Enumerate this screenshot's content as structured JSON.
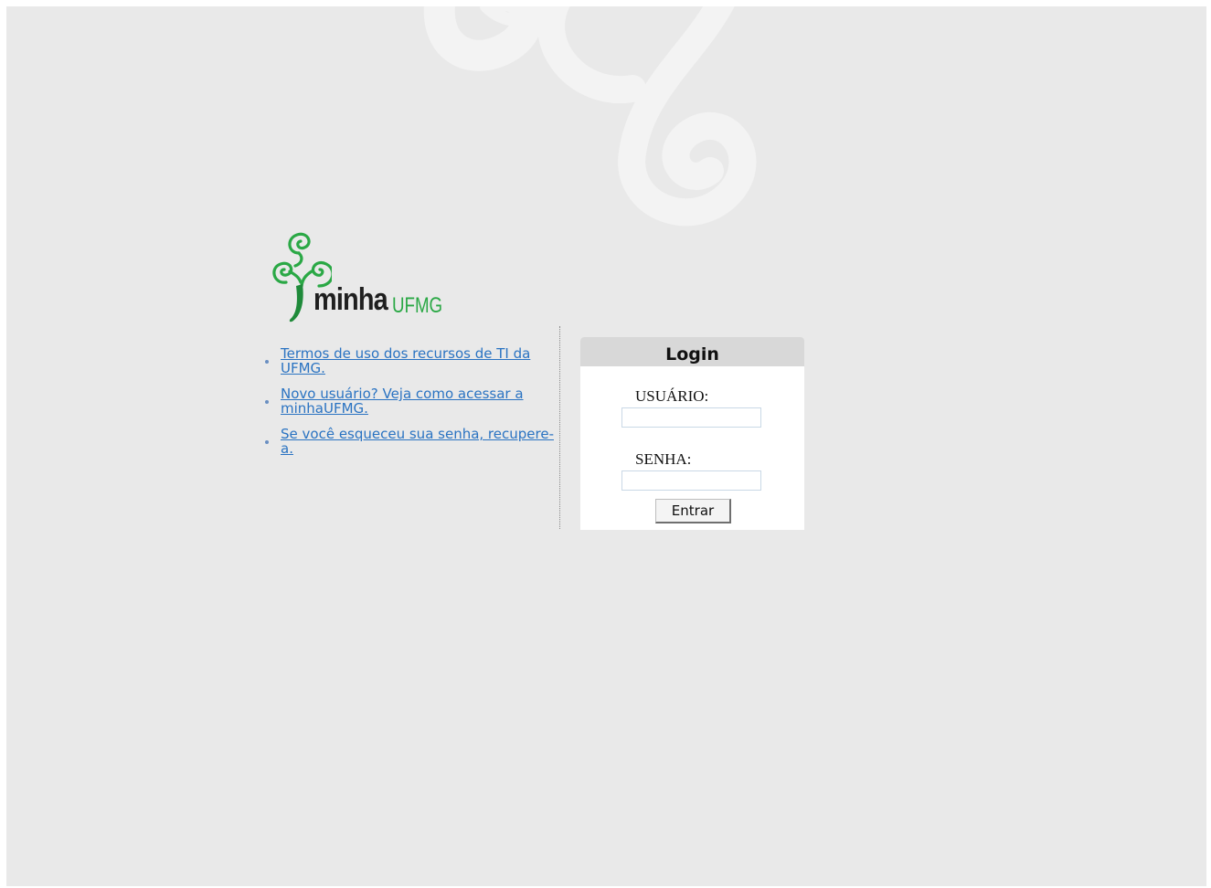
{
  "brand": {
    "logo_word_1": "minha",
    "logo_word_2": "UFMG",
    "logo_icon": "spiral-tree-icon",
    "primary_green": "#2aa845",
    "dark_green": "#1f8a3a"
  },
  "links": [
    {
      "label": "Termos de uso dos recursos de TI da UFMG."
    },
    {
      "label": "Novo usuário? Veja como acessar a minhaUFMG."
    },
    {
      "label": "Se você esqueceu sua senha, recupere-a."
    }
  ],
  "login": {
    "title": "Login",
    "username_label": "USUÁRIO:",
    "username_value": "",
    "password_label": "SENHA:",
    "password_value": "",
    "submit_label": "Entrar"
  },
  "colors": {
    "background": "#e9e9e9",
    "link": "#2a73c2",
    "login_header": "#d8d8d8"
  }
}
